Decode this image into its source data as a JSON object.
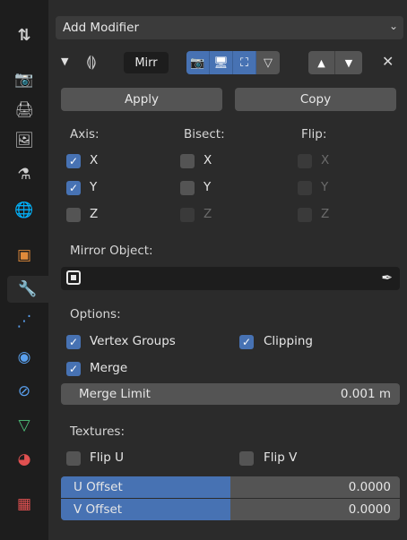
{
  "tabs": [
    {
      "icon": "tool-icon",
      "glyph": "⇅"
    },
    {
      "icon": "render-icon",
      "glyph": "📷"
    },
    {
      "icon": "output-icon",
      "glyph": "🖨"
    },
    {
      "icon": "view-layer-icon",
      "glyph": "🖼"
    },
    {
      "icon": "scene-icon",
      "glyph": "⚗"
    },
    {
      "icon": "world-icon",
      "glyph": "🌐"
    },
    {
      "icon": "object-icon",
      "glyph": "▣"
    },
    {
      "icon": "modifier-wrench-icon",
      "glyph": "🔧"
    },
    {
      "icon": "particles-icon",
      "glyph": "⋰"
    },
    {
      "icon": "physics-icon",
      "glyph": "◉"
    },
    {
      "icon": "constraints-icon",
      "glyph": "⊘"
    },
    {
      "icon": "object-data-icon",
      "glyph": "▽"
    },
    {
      "icon": "material-icon",
      "glyph": "◕"
    },
    {
      "icon": "texture-icon",
      "glyph": "▦"
    }
  ],
  "add_modifier": {
    "label": "Add Modifier",
    "chevron": "⌄"
  },
  "modifier_header": {
    "collapse_glyph": "▼",
    "mirror_icon_glyph": "⟬⟭",
    "name": "Mirr",
    "toggle_glyphs": [
      "📷",
      "🖥",
      "⛶",
      "▽"
    ],
    "move_up_glyph": "▲",
    "move_down_glyph": "▼",
    "close_glyph": "✕"
  },
  "actions": {
    "apply_label": "Apply",
    "copy_label": "Copy"
  },
  "columns": {
    "axis_label": "Axis:",
    "bisect_label": "Bisect:",
    "flip_label": "Flip:"
  },
  "axis": [
    {
      "label": "X",
      "checked": true
    },
    {
      "label": "Y",
      "checked": true
    },
    {
      "label": "Z",
      "checked": false
    }
  ],
  "bisect": [
    {
      "label": "X",
      "checked": false
    },
    {
      "label": "Y",
      "checked": false
    },
    {
      "label": "Z",
      "checked": false
    }
  ],
  "flip": [
    {
      "label": "X",
      "checked": false
    },
    {
      "label": "Y",
      "checked": false
    },
    {
      "label": "Z",
      "checked": false
    }
  ],
  "mirror_object": {
    "label": "Mirror Object:",
    "value": ""
  },
  "options": {
    "label": "Options:",
    "vertex_groups_label": "Vertex Groups",
    "vertex_groups_checked": true,
    "clipping_label": "Clipping",
    "clipping_checked": true,
    "merge_label": "Merge",
    "merge_checked": true,
    "merge_limit_label": "Merge Limit",
    "merge_limit_value": "0.001 m"
  },
  "textures": {
    "label": "Textures:",
    "flip_u_label": "Flip U",
    "flip_u_checked": false,
    "flip_v_label": "Flip V",
    "flip_v_checked": false,
    "u_offset_label": "U Offset",
    "u_offset_value": "0.0000",
    "v_offset_label": "V Offset",
    "v_offset_value": "0.0000",
    "offset_fill_fraction": 0.5
  },
  "colors": {
    "accent": "#4772b3",
    "panel_bg": "#2b2b2b",
    "tab_bg": "#1d1d1d",
    "widget_bg": "#545454",
    "field_bg": "#1d1d1d"
  }
}
